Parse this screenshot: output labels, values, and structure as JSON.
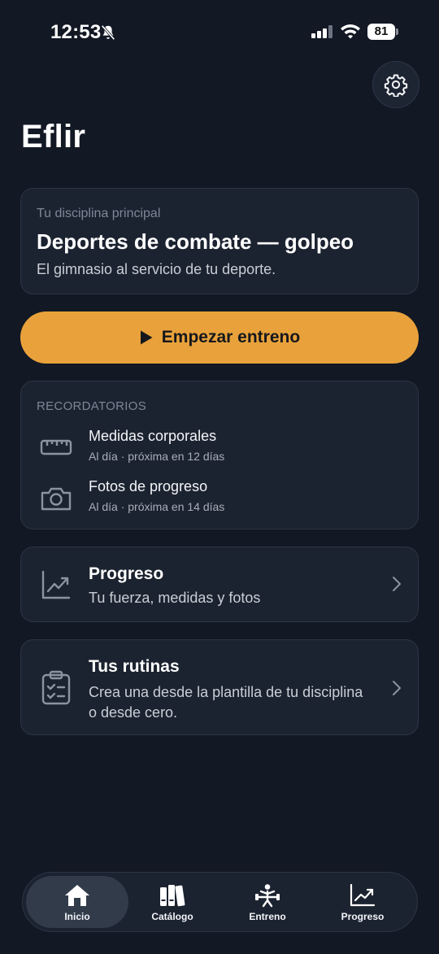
{
  "status_bar": {
    "time": "12:53",
    "battery": "81"
  },
  "header": {
    "app_title": "Eflir"
  },
  "discipline": {
    "label": "Tu disciplina principal",
    "title": "Deportes de combate — golpeo",
    "subtitle": "El gimnasio al servicio de tu deporte."
  },
  "start_button": {
    "label": "Empezar entreno"
  },
  "reminders": {
    "header": "RECORDATORIOS",
    "items": [
      {
        "title": "Medidas corporales",
        "detail": "Al día · próxima en 12 días",
        "icon": "ruler-icon"
      },
      {
        "title": "Fotos de progreso",
        "detail": "Al día · próxima en 14 días",
        "icon": "camera-icon"
      }
    ]
  },
  "progress_card": {
    "title": "Progreso",
    "subtitle": "Tu fuerza, medidas y fotos"
  },
  "routines_card": {
    "title": "Tus rutinas",
    "subtitle": "Crea una desde la plantilla de tu disciplina o desde cero."
  },
  "tabbar": {
    "tabs": [
      {
        "label": "Inicio",
        "icon": "home-icon",
        "active": true
      },
      {
        "label": "Catálogo",
        "icon": "books-icon",
        "active": false
      },
      {
        "label": "Entreno",
        "icon": "weightlifter-icon",
        "active": false
      },
      {
        "label": "Progreso",
        "icon": "chart-up-icon",
        "active": false
      }
    ]
  },
  "colors": {
    "background": "#121824",
    "card": "#1c2330",
    "accent": "#e9a23b"
  }
}
